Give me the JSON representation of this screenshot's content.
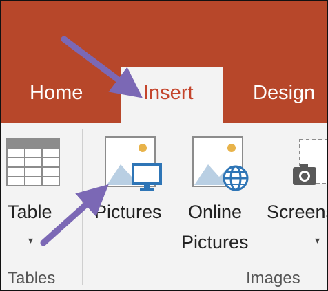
{
  "tabs": {
    "home": "Home",
    "insert": "Insert",
    "design": "Design"
  },
  "ribbon": {
    "table_button": {
      "label": "Table",
      "caret": "▾"
    },
    "pictures_button": {
      "label": "Pictures"
    },
    "online_pictures_button": {
      "label_line1": "Online",
      "label_line2": "Pictures"
    },
    "screenshot_button": {
      "label": "Screenshot",
      "caret": "▾"
    },
    "groups": {
      "tables": "Tables",
      "images": "Images"
    }
  },
  "colors": {
    "title_bar": "#b7472a",
    "active_tab_text": "#c4442b",
    "ribbon_bg": "#f3f3f3",
    "annotation_arrow": "#7b68b5",
    "icon_blue": "#2e75b6",
    "icon_gold": "#e8b34a"
  },
  "icons": [
    "table-icon",
    "pictures-icon",
    "online-pictures-icon",
    "screenshot-icon",
    "arrow-annotation"
  ]
}
